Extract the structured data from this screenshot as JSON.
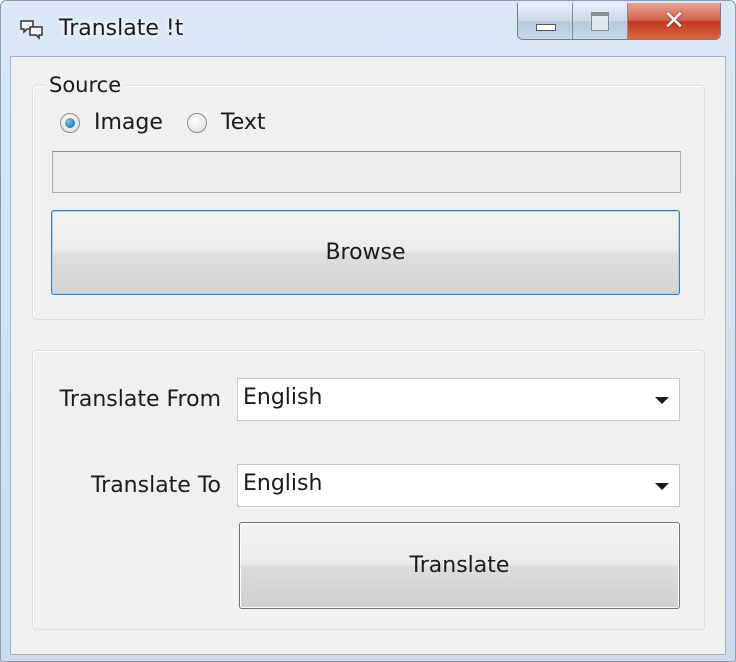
{
  "window": {
    "title": "Translate !t",
    "icon": "translate-app-icon",
    "buttons": {
      "minimize": "minimize-icon",
      "maximize": "maximize-icon",
      "close": "close-icon"
    }
  },
  "source": {
    "legend": "Source",
    "options": [
      {
        "label": "Image",
        "selected": true
      },
      {
        "label": "Text",
        "selected": false
      }
    ],
    "path_value": "",
    "browse_label": "Browse"
  },
  "translate": {
    "from_label": "Translate From",
    "from_value": "English",
    "to_label": "Translate To",
    "to_value": "English",
    "translate_label": "Translate"
  },
  "colors": {
    "accent": "#3c7fb1",
    "close_button": "#c4391d",
    "dialog_background": "#f0f0f0"
  }
}
